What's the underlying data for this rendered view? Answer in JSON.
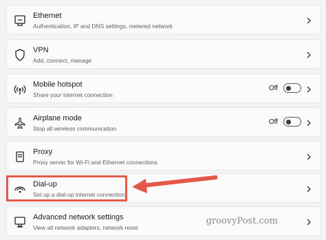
{
  "rows": [
    {
      "title": "Ethernet",
      "sub": "Authentication, IP and DNS settings, metered network",
      "icon": "ethernet-icon"
    },
    {
      "title": "VPN",
      "sub": "Add, connect, manage",
      "icon": "vpn-shield-icon"
    },
    {
      "title": "Mobile hotspot",
      "sub": "Share your internet connection",
      "icon": "hotspot-icon",
      "toggle": "Off"
    },
    {
      "title": "Airplane mode",
      "sub": "Stop all wireless communication",
      "icon": "airplane-icon",
      "toggle": "Off"
    },
    {
      "title": "Proxy",
      "sub": "Proxy server for Wi-Fi and Ethernet connections",
      "icon": "proxy-server-icon"
    },
    {
      "title": "Dial-up",
      "sub": "Set up a dial-up internet connection",
      "icon": "dialup-icon"
    },
    {
      "title": "Advanced network settings",
      "sub": "View all network adapters, network reset",
      "icon": "advanced-network-icon"
    }
  ],
  "watermark": "groovyPost.com",
  "colors": {
    "highlight": "#e55747",
    "background": "#f3f3f3",
    "card": "#fbfbfb"
  }
}
